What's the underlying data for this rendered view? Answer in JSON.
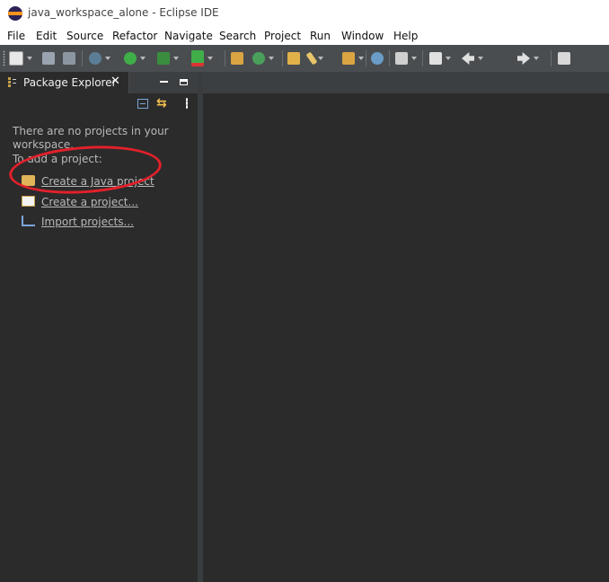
{
  "window": {
    "title": "java_workspace_alone - Eclipse IDE"
  },
  "menu": {
    "items": [
      "File",
      "Edit",
      "Source",
      "Refactor",
      "Navigate",
      "Search",
      "Project",
      "Run",
      "Window",
      "Help"
    ]
  },
  "toolbar": {
    "icons": [
      "new-icon",
      "save-icon",
      "save-all-icon",
      "debug-icon",
      "run-icon",
      "coverage-icon",
      "external-tools-icon",
      "new-java-package-icon",
      "new-java-class-icon",
      "open-type-icon",
      "pencil-icon",
      "open-task-icon",
      "search-icon",
      "annotation-nav-icon",
      "last-edit-icon",
      "back-icon",
      "forward-icon",
      "open-perspective-icon"
    ]
  },
  "package_explorer": {
    "tab_label": "Package Explorer",
    "close_glyph": "✕",
    "empty_message_line1": "There are no projects in your",
    "empty_message_line2": "workspace.",
    "add_prompt": "To add a project:",
    "links": [
      {
        "label": "Create a Java project",
        "icon": "new-java-project-icon"
      },
      {
        "label": "Create a project...",
        "icon": "new-project-icon"
      },
      {
        "label": "Import projects...",
        "icon": "import-icon"
      }
    ]
  },
  "colors": {
    "annotation": "#e3202a",
    "background": "#2b2b2b",
    "toolbar": "#4a4d50"
  }
}
